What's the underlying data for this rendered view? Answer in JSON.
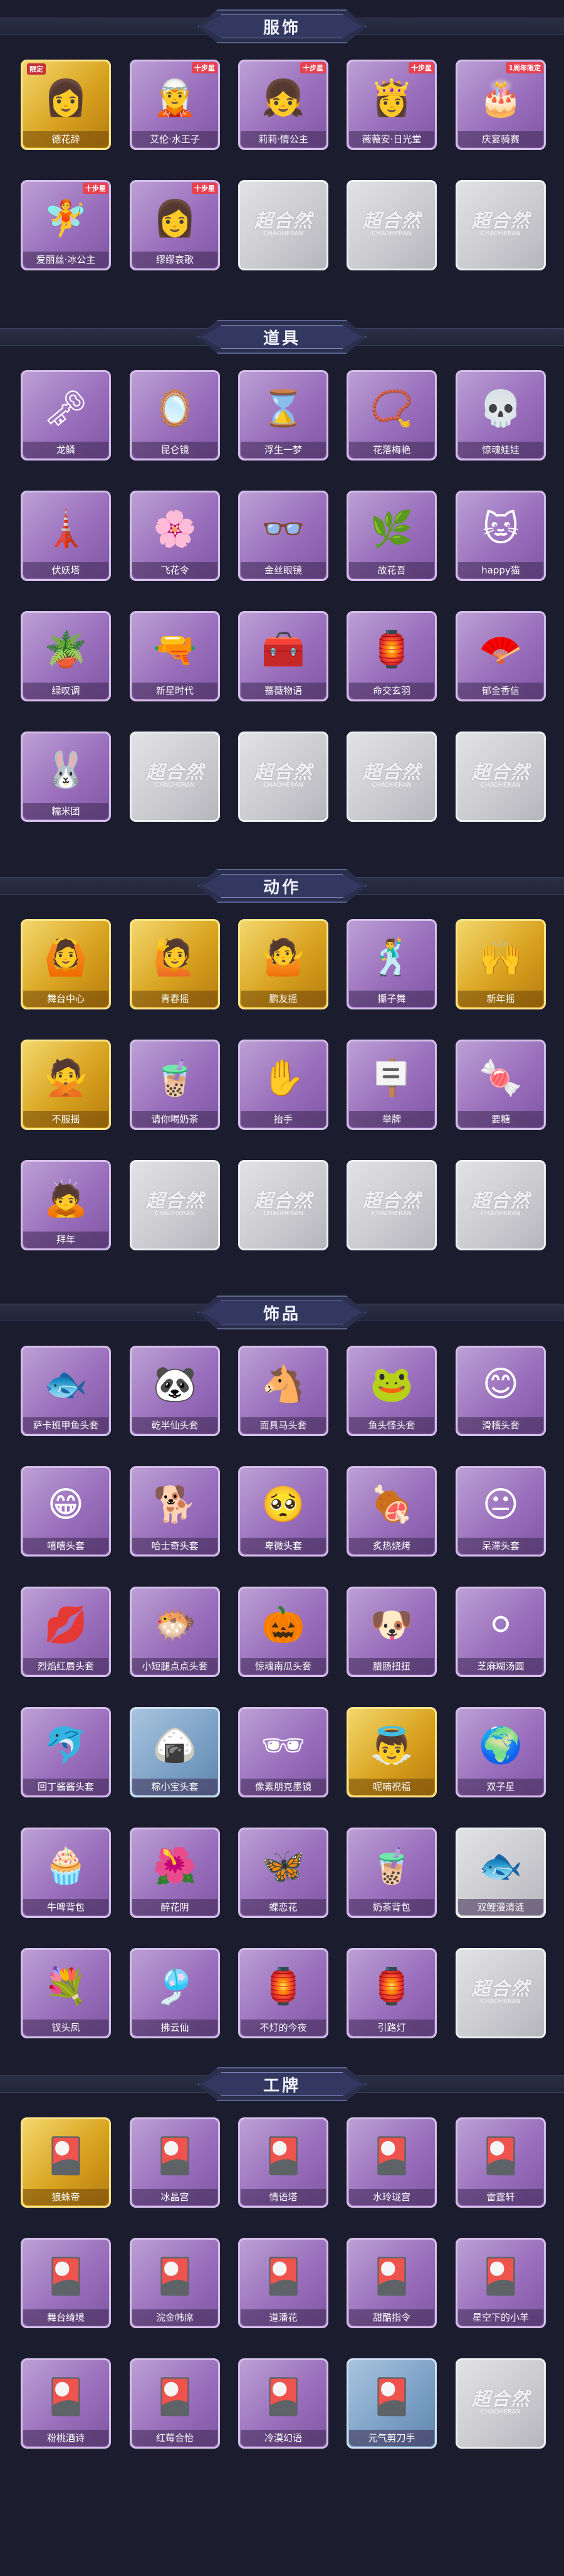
{
  "sections": [
    {
      "title": "服饰",
      "items": [
        {
          "label": "德花辞",
          "tier": "gold",
          "tag": "限定",
          "icon": "👩"
        },
        {
          "label": "艾伦·水王子",
          "tier": "purple",
          "tag": "十步星",
          "icon": "🧝"
        },
        {
          "label": "莉莉·情公主",
          "tier": "purple",
          "tag": "十步星",
          "icon": "👧"
        },
        {
          "label": "薇薇安·日光堂",
          "tier": "purple",
          "tag": "十步星",
          "icon": "👸"
        },
        {
          "label": "庆宴骑赛",
          "tier": "purple",
          "tag": "1周年限定",
          "icon": "🎂"
        },
        {
          "label": "爱丽丝·冰公主",
          "tier": "purple",
          "tag": "十步星",
          "icon": "🧚"
        },
        {
          "label": "缪缪哀歌",
          "tier": "purple",
          "tag": "十步星",
          "icon": "👩"
        },
        {
          "label": "",
          "tier": "grey",
          "tag": "",
          "icon": ""
        },
        {
          "label": "",
          "tier": "grey",
          "tag": "",
          "icon": ""
        },
        {
          "label": "",
          "tier": "grey",
          "tag": "",
          "icon": ""
        }
      ]
    },
    {
      "title": "道具",
      "items": [
        {
          "label": "龙鳞",
          "tier": "purple",
          "tag": "",
          "icon": "🗝"
        },
        {
          "label": "昆仑镜",
          "tier": "purple",
          "tag": "",
          "icon": "🪞"
        },
        {
          "label": "浮生一梦",
          "tier": "purple",
          "tag": "",
          "icon": "⌛"
        },
        {
          "label": "花落梅艳",
          "tier": "purple",
          "tag": "",
          "icon": "📿"
        },
        {
          "label": "惊魂娃娃",
          "tier": "purple",
          "tag": "",
          "icon": "💀"
        },
        {
          "label": "伏妖塔",
          "tier": "purple",
          "tag": "",
          "icon": "🗼"
        },
        {
          "label": "飞花令",
          "tier": "purple",
          "tag": "",
          "icon": "🌸"
        },
        {
          "label": "金丝眼镜",
          "tier": "purple",
          "tag": "",
          "icon": "👓"
        },
        {
          "label": "故花吾",
          "tier": "purple",
          "tag": "",
          "icon": "🌿"
        },
        {
          "label": "happy猫",
          "tier": "purple",
          "tag": "",
          "icon": "🐱"
        },
        {
          "label": "绿叹调",
          "tier": "purple",
          "tag": "",
          "icon": "🪴"
        },
        {
          "label": "新星时代",
          "tier": "purple",
          "tag": "",
          "icon": "🔫"
        },
        {
          "label": "蔷薇物语",
          "tier": "purple",
          "tag": "",
          "icon": "🧰"
        },
        {
          "label": "命交玄羽",
          "tier": "purple",
          "tag": "",
          "icon": "🏮"
        },
        {
          "label": "郁金香信",
          "tier": "purple",
          "tag": "",
          "icon": "🪭"
        },
        {
          "label": "糯米团",
          "tier": "purple",
          "tag": "",
          "icon": "🐰"
        },
        {
          "label": "",
          "tier": "grey",
          "tag": "",
          "icon": ""
        },
        {
          "label": "",
          "tier": "grey",
          "tag": "",
          "icon": ""
        },
        {
          "label": "",
          "tier": "grey",
          "tag": "",
          "icon": ""
        },
        {
          "label": "",
          "tier": "grey",
          "tag": "",
          "icon": ""
        }
      ]
    },
    {
      "title": "动作",
      "items": [
        {
          "label": "舞台中心",
          "tier": "gold",
          "tag": "",
          "icon": "🙆"
        },
        {
          "label": "青春摇",
          "tier": "gold",
          "tag": "",
          "icon": "🙋"
        },
        {
          "label": "鹏友摇",
          "tier": "gold",
          "tag": "",
          "icon": "🤷"
        },
        {
          "label": "攥子舞",
          "tier": "purple",
          "tag": "",
          "icon": "🕺"
        },
        {
          "label": "新年摇",
          "tier": "gold",
          "tag": "",
          "icon": "🙌"
        },
        {
          "label": "不服摇",
          "tier": "gold",
          "tag": "",
          "icon": "🙅"
        },
        {
          "label": "请你喝奶茶",
          "tier": "purple",
          "tag": "",
          "icon": "🧋"
        },
        {
          "label": "抬手",
          "tier": "purple",
          "tag": "",
          "icon": "✋"
        },
        {
          "label": "举牌",
          "tier": "purple",
          "tag": "",
          "icon": "🪧"
        },
        {
          "label": "要糖",
          "tier": "purple",
          "tag": "",
          "icon": "🍬"
        },
        {
          "label": "拜年",
          "tier": "purple",
          "tag": "",
          "icon": "🙇"
        },
        {
          "label": "",
          "tier": "grey",
          "tag": "",
          "icon": ""
        },
        {
          "label": "",
          "tier": "grey",
          "tag": "",
          "icon": ""
        },
        {
          "label": "",
          "tier": "grey",
          "tag": "",
          "icon": ""
        },
        {
          "label": "",
          "tier": "grey",
          "tag": "",
          "icon": ""
        }
      ]
    },
    {
      "title": "饰品",
      "items": [
        {
          "label": "萨卡班甲鱼头套",
          "tier": "purple",
          "tag": "",
          "icon": "🐟"
        },
        {
          "label": "乾半仙头套",
          "tier": "purple",
          "tag": "",
          "icon": "🐼"
        },
        {
          "label": "面具马头套",
          "tier": "purple",
          "tag": "",
          "icon": "🐴"
        },
        {
          "label": "鱼头怪头套",
          "tier": "purple",
          "tag": "",
          "icon": "🐸"
        },
        {
          "label": "滑稽头套",
          "tier": "purple",
          "tag": "",
          "icon": "😊"
        },
        {
          "label": "嘻嘻头套",
          "tier": "purple",
          "tag": "",
          "icon": "😁"
        },
        {
          "label": "哈士奇头套",
          "tier": "purple",
          "tag": "",
          "icon": "🐕"
        },
        {
          "label": "卑微头套",
          "tier": "purple",
          "tag": "",
          "icon": "🥺"
        },
        {
          "label": "炙热烧烤",
          "tier": "purple",
          "tag": "",
          "icon": "🍖"
        },
        {
          "label": "呆滞头套",
          "tier": "purple",
          "tag": "",
          "icon": "😐"
        },
        {
          "label": "烈焰红唇头套",
          "tier": "purple",
          "tag": "",
          "icon": "💋"
        },
        {
          "label": "小短腿点点头套",
          "tier": "purple",
          "tag": "",
          "icon": "🐡"
        },
        {
          "label": "惊魂南瓜头套",
          "tier": "purple",
          "tag": "",
          "icon": "🎃"
        },
        {
          "label": "腊肠扭扭",
          "tier": "purple",
          "tag": "",
          "icon": "🐶"
        },
        {
          "label": "芝麻糊汤圆",
          "tier": "purple",
          "tag": "",
          "icon": "⚪"
        },
        {
          "label": "回丁酱酱头套",
          "tier": "purple",
          "tag": "",
          "icon": "🐬"
        },
        {
          "label": "粽小宝头套",
          "tier": "blue",
          "tag": "",
          "icon": "🍙"
        },
        {
          "label": "像素朋克墨镜",
          "tier": "purple",
          "tag": "",
          "icon": "🕶"
        },
        {
          "label": "呢喃祝福",
          "tier": "gold",
          "tag": "",
          "icon": "👼"
        },
        {
          "label": "双子星",
          "tier": "purple",
          "tag": "",
          "icon": "🌍"
        },
        {
          "label": "牛啤背包",
          "tier": "purple",
          "tag": "",
          "icon": "🧁"
        },
        {
          "label": "醉花阴",
          "tier": "purple",
          "tag": "",
          "icon": "🌺"
        },
        {
          "label": "蝶恋花",
          "tier": "purple",
          "tag": "",
          "icon": "🦋"
        },
        {
          "label": "奶茶背包",
          "tier": "purple",
          "tag": "",
          "icon": "🧋"
        },
        {
          "label": "双鲤漫清涟",
          "tier": "grey",
          "tag": "",
          "icon": "🐟"
        },
        {
          "label": "钗头凤",
          "tier": "purple",
          "tag": "",
          "icon": "💐"
        },
        {
          "label": "拂云仙",
          "tier": "purple",
          "tag": "",
          "icon": "🎐"
        },
        {
          "label": "不灯的今夜",
          "tier": "purple",
          "tag": "",
          "icon": "🏮"
        },
        {
          "label": "引路灯",
          "tier": "purple",
          "tag": "",
          "icon": "🏮"
        },
        {
          "label": "",
          "tier": "grey",
          "tag": "",
          "icon": ""
        }
      ]
    },
    {
      "title": "工牌",
      "items": [
        {
          "label": "狼蛛帝",
          "tier": "gold",
          "tag": "",
          "icon": "🎴"
        },
        {
          "label": "冰晶宫",
          "tier": "purple",
          "tag": "",
          "icon": "🎴"
        },
        {
          "label": "情语塔",
          "tier": "purple",
          "tag": "",
          "icon": "🎴"
        },
        {
          "label": "水玲珑宫",
          "tier": "purple",
          "tag": "",
          "icon": "🎴"
        },
        {
          "label": "雷霆轩",
          "tier": "purple",
          "tag": "",
          "icon": "🎴"
        },
        {
          "label": "舞台绮境",
          "tier": "purple",
          "tag": "",
          "icon": "🎴"
        },
        {
          "label": "浣金帏席",
          "tier": "purple",
          "tag": "",
          "icon": "🎴"
        },
        {
          "label": "道潘花",
          "tier": "purple",
          "tag": "",
          "icon": "🎴"
        },
        {
          "label": "甜酷指令",
          "tier": "purple",
          "tag": "",
          "icon": "🎴"
        },
        {
          "label": "星空下的小羊",
          "tier": "purple",
          "tag": "",
          "icon": "🎴"
        },
        {
          "label": "粉桃酒诗",
          "tier": "purple",
          "tag": "",
          "icon": "🎴"
        },
        {
          "label": "红莓合怡",
          "tier": "purple",
          "tag": "",
          "icon": "🎴"
        },
        {
          "label": "冷漠幻语",
          "tier": "purple",
          "tag": "",
          "icon": "🎴"
        },
        {
          "label": "元气剪刀手",
          "tier": "blue",
          "tag": "",
          "icon": "🎴"
        },
        {
          "label": "",
          "tier": "grey",
          "tag": "",
          "icon": ""
        }
      ]
    }
  ],
  "watermark": {
    "main": "超合然",
    "sub": "CHAOHERAN"
  }
}
